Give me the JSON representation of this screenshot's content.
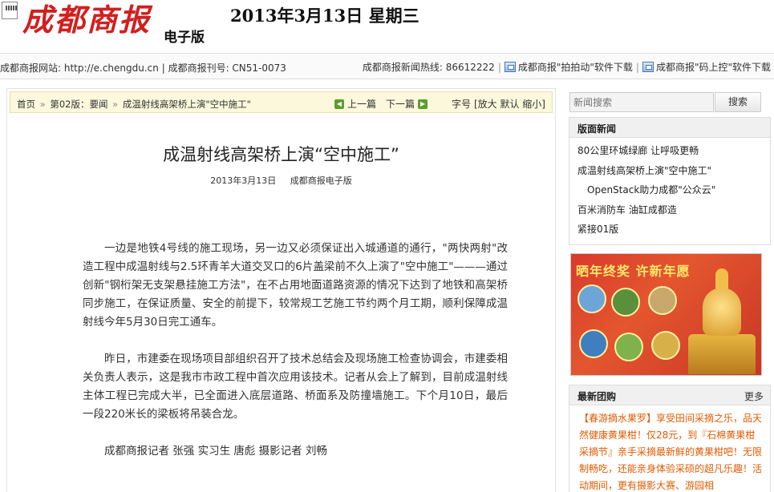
{
  "header": {
    "logo_text": "成都商报",
    "edition": "电子版",
    "date": "2013年3月13日 星期三"
  },
  "infobar": {
    "website_label": "成都商报网站: http://e.chengdu.cn",
    "issn": "成都商报刊号: CN51-0073",
    "hotline": "成都商报新闻热线: 86612222",
    "download1": "成都商报\"拍拍动\"软件下载",
    "download2": "成都商报\"码上控\"软件下载"
  },
  "breadcrumb": {
    "home": "首页",
    "section": "第02版：要闻",
    "current": "成温射线高架桥上演\"空中施工\"",
    "prev": "上一篇",
    "next": "下一篇",
    "font_label": "字号",
    "font_options": "[放大 默认 缩小]"
  },
  "article": {
    "title": "成温射线高架桥上演“空中施工”",
    "date": "2013年3月13日",
    "source": "成都商报电子版",
    "paragraphs": [
      "一边是地铁4号线的施工现场，另一边又必须保证出入城通道的通行，\"两快两射\"改造工程中成温射线与2.5环青羊大道交叉口的6片盖梁前不久上演了\"空中施工\"———通过创新\"钢桁架无支架悬挂施工方法\"，在不占用地面道路资源的情况下达到了地铁和高架桥同步施工，在保证质量、安全的前提下，较常规工艺施工节约两个月工期，顺利保障成温射线今年5月30日完工通车。",
      "昨日，市建委在现场项目部组织召开了技术总结会及现场施工检查协调会，市建委相关负责人表示，这是我市市政工程中首次应用该技术。记者从会上了解到，目前成温射线主体工程已完成大半，已全面进入底层道路、桥面系及防撞墙施工。下个月10日，最后一段220米长的梁板将吊装合龙。",
      "成都商报记者 张强 实习生 唐彪 摄影记者 刘畅"
    ]
  },
  "sidebar": {
    "search_placeholder": "新闻搜索",
    "search_button": "搜索",
    "section_news_title": "版面新闻",
    "section_news": [
      "80公里环城绿廊 让呼吸更畅",
      "成温射线高架桥上演\"空中施工\"",
      "OpenStack助力成都\"公众云\"",
      "百米消防车 油缸成都造",
      "紧接01版"
    ],
    "banner_title": "晒年终奖 许新年愿",
    "group_buy_title": "最新团购",
    "group_buy_more": "更多",
    "group_buy_text": "【春游摘水果罗】享受田间采摘之乐，品天然健康黄果柑！仅28元，到『石棉黄果柑采摘节』亲手采摘最新鲜的黄果柑吧！无限制畅吃，还能亲身体验采硕的超凡乐趣！活动期间，更有摄影大赛、游园相"
  },
  "colors": {
    "brand_red": "#d21f1f",
    "breadcrumb_bg": "#fbf8dc",
    "group_buy_text": "#e05a00"
  }
}
